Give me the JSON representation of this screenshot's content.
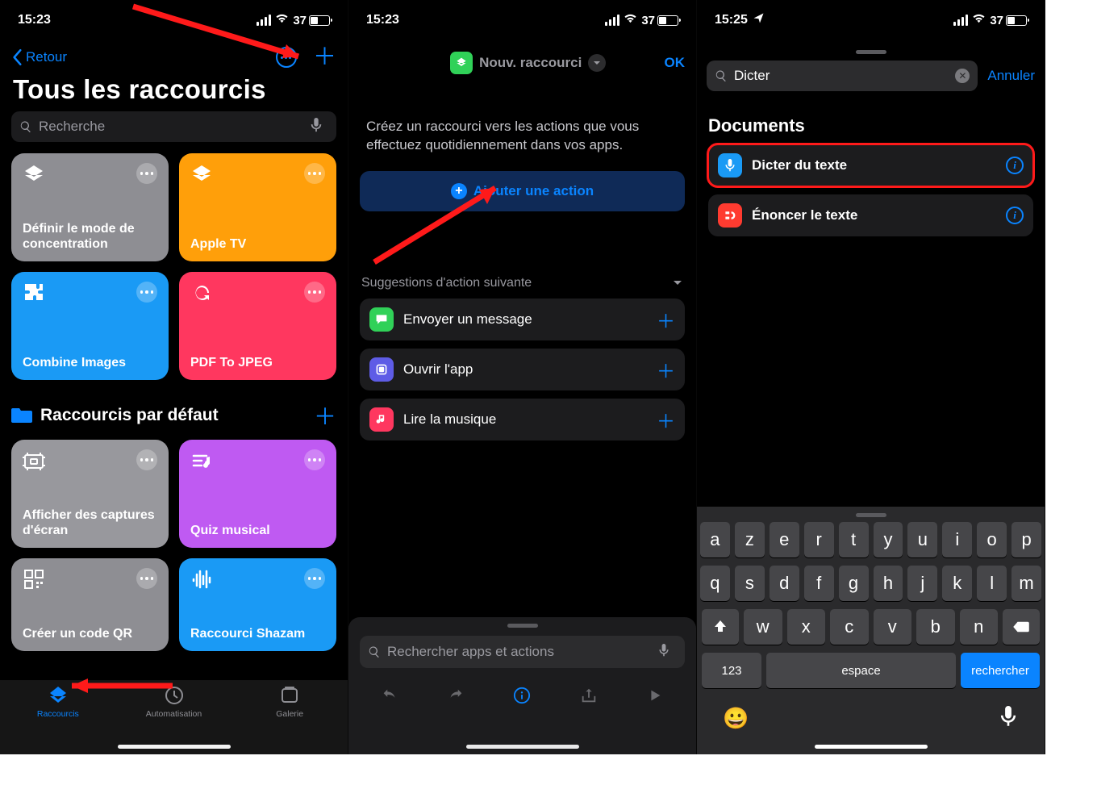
{
  "status": {
    "time1": "15:23",
    "time2": "15:23",
    "time3": "15:25",
    "battery_pct": "37"
  },
  "panel1": {
    "back_label": "Retour",
    "title": "Tous les raccourcis",
    "search_placeholder": "Recherche",
    "tiles": [
      {
        "label": "Définir le mode de concentration",
        "color": "#8e8e93"
      },
      {
        "label": "Apple TV",
        "color": "#ff9f0a"
      },
      {
        "label": "Combine Images",
        "color": "#1a9af5"
      },
      {
        "label": "PDF To JPEG",
        "color": "#ff375f"
      }
    ],
    "folder_label": "Raccourcis par défaut",
    "tiles2": [
      {
        "label": "Afficher des captures d'écran",
        "color": "#98989d"
      },
      {
        "label": "Quiz musical",
        "color": "#bf5af2"
      },
      {
        "label": "Créer un code QR",
        "color": "#8e8e93"
      },
      {
        "label": "Raccourci Shazam",
        "color": "#1a9af5"
      }
    ],
    "tabs": [
      "Raccourcis",
      "Automatisation",
      "Galerie"
    ]
  },
  "panel2": {
    "header_label": "Nouv. raccourci",
    "ok_label": "OK",
    "instruction": "Créez un raccourci vers les actions que vous effectuez quotidiennement dans vos apps.",
    "add_action_label": "Ajouter une action",
    "suggestions_header": "Suggestions d'action suivante",
    "suggestions": [
      {
        "label": "Envoyer un message",
        "color": "#30d158"
      },
      {
        "label": "Ouvrir l'app",
        "color": "#5e5ce6"
      },
      {
        "label": "Lire la musique",
        "color": "#ff375f"
      }
    ],
    "search_placeholder": "Rechercher apps et actions"
  },
  "panel3": {
    "search_value": "Dicter",
    "cancel_label": "Annuler",
    "section_header": "Documents",
    "actions": [
      {
        "label": "Dicter du texte",
        "color": "#1a9af5",
        "highlight": true
      },
      {
        "label": "Énoncer le texte",
        "color": "#ff3b30",
        "highlight": false
      }
    ],
    "keyboard": {
      "row1": [
        "a",
        "z",
        "e",
        "r",
        "t",
        "y",
        "u",
        "i",
        "o",
        "p"
      ],
      "row2": [
        "q",
        "s",
        "d",
        "f",
        "g",
        "h",
        "j",
        "k",
        "l",
        "m"
      ],
      "row3": [
        "w",
        "x",
        "c",
        "v",
        "b",
        "n"
      ],
      "numkey": "123",
      "space": "espace",
      "search": "rechercher"
    }
  }
}
